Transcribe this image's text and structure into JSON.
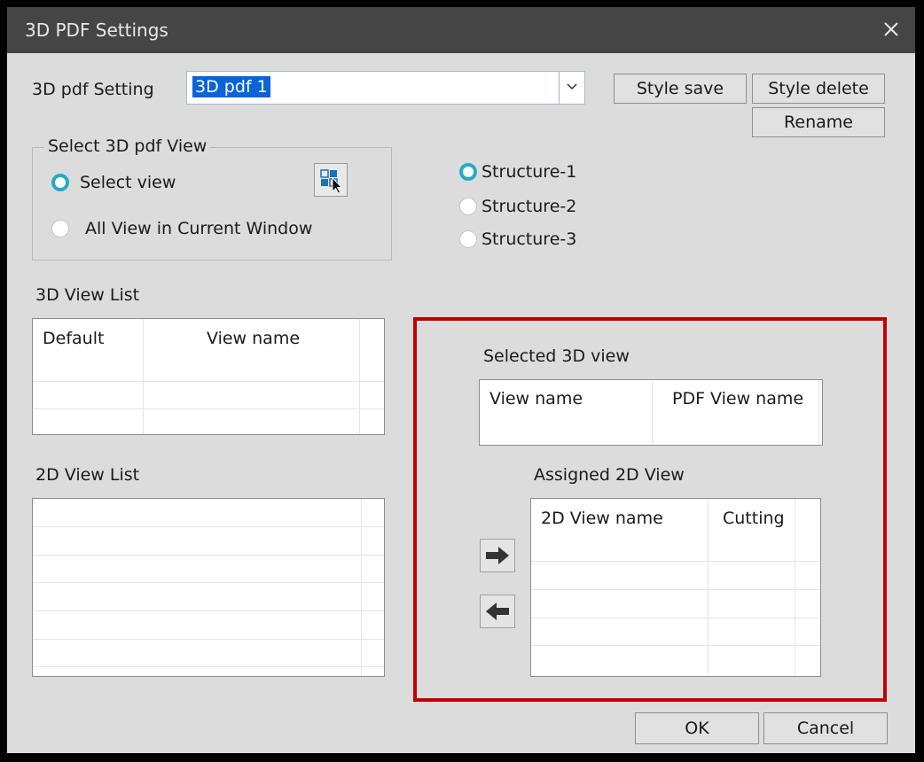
{
  "window": {
    "title": "3D PDF Settings"
  },
  "setting": {
    "label": "3D pdf Setting",
    "value": "3D pdf  1"
  },
  "buttons": {
    "style_save": "Style save",
    "style_delete": "Style delete",
    "rename": "Rename",
    "ok": "OK",
    "cancel": "Cancel"
  },
  "select_view_group": {
    "title": "Select 3D pdf View",
    "option_select": "Select view",
    "option_all": "All View in Current Window",
    "selected": "Select view"
  },
  "structures": {
    "s1": "Structure-1",
    "s2": "Structure-2",
    "s3": "Structure-3",
    "selected": "Structure-1"
  },
  "view3d_list": {
    "label": "3D View List",
    "columns": [
      "Default",
      "View name"
    ]
  },
  "view2d_list": {
    "label": "2D View List"
  },
  "selected_3d": {
    "label": "Selected 3D view",
    "columns": [
      "View name",
      "PDF View name"
    ]
  },
  "assigned_2d": {
    "label": "Assigned 2D View",
    "columns": [
      "2D View name",
      "Cutting"
    ]
  },
  "colors": {
    "accent_radio": "#27a9c8",
    "highlight_box": "#c00000",
    "selection": "#0a64d6",
    "titlebar": "#454545"
  },
  "icons": [
    "close-icon",
    "chevron-down-icon",
    "view-picker-icon",
    "arrow-right-icon",
    "arrow-left-icon"
  ]
}
